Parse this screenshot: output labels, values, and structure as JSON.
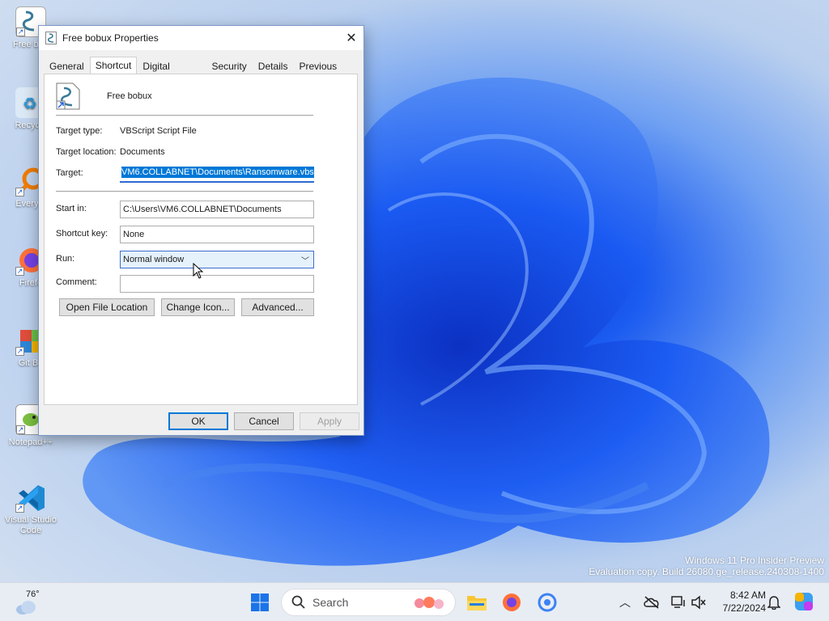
{
  "desktop": {
    "icons": [
      {
        "label": "Free bob",
        "icon": "vbscript-file-icon"
      },
      {
        "label": "Recycle",
        "icon": "recycle-bin-icon"
      },
      {
        "label": "Everyth",
        "icon": "everything-search-icon"
      },
      {
        "label": "Firefo",
        "icon": "firefox-icon"
      },
      {
        "label": "Git Ba",
        "icon": "git-bash-icon"
      },
      {
        "label": "Notepad++",
        "icon": "notepadpp-icon"
      },
      {
        "label": "Visual Studio Code",
        "icon": "vscode-icon"
      }
    ],
    "watermark_line1": "Windows 11 Pro Insider Preview",
    "watermark_line2": "Evaluation copy. Build 26080.ge_release.240308-1400"
  },
  "dialog": {
    "title": "Free bobux Properties",
    "tabs": [
      "General",
      "Shortcut",
      "Digital Signatures",
      "Security",
      "Details",
      "Previous Versions"
    ],
    "active_tab": "Shortcut",
    "file_name": "Free bobux",
    "target_type_label": "Target type:",
    "target_type_value": "VBScript Script File",
    "target_location_label": "Target location:",
    "target_location_value": "Documents",
    "target_label": "Target:",
    "target_value": "VM6.COLLABNET\\Documents\\Ransomware.vbs",
    "start_in_label": "Start in:",
    "start_in_value": "C:\\Users\\VM6.COLLABNET\\Documents",
    "shortcut_key_label": "Shortcut key:",
    "shortcut_key_value": "None",
    "run_label": "Run:",
    "run_value": "Normal window",
    "comment_label": "Comment:",
    "comment_value": "",
    "buttons": {
      "open_file_location": "Open File Location",
      "change_icon": "Change Icon...",
      "advanced": "Advanced...",
      "ok": "OK",
      "cancel": "Cancel",
      "apply": "Apply"
    }
  },
  "taskbar": {
    "weather_temp": "76°",
    "search_label": "Search",
    "time": "8:42 AM",
    "date": "7/22/2024",
    "colors": {
      "accent": "#0078d7"
    }
  }
}
